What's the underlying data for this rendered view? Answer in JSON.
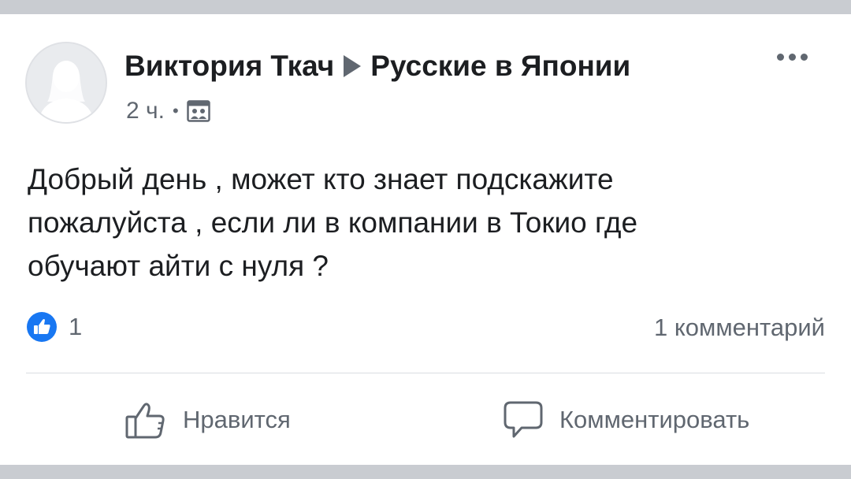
{
  "post": {
    "author": "Виктория Ткач",
    "group": "Русские в Японии",
    "time": "2 ч.",
    "separator": "•",
    "audience_icon": "group-audience-icon",
    "text": "Добрый день  , может кто знает подскажите\nпожалуйста , если ли в компании в Токио  где\nобучают айти с нуля ?"
  },
  "stats": {
    "reaction_icon": "like-reaction-icon",
    "reaction_count": "1",
    "comments": "1 комментарий"
  },
  "actions": {
    "like_label": "Нравится",
    "comment_label": "Комментировать"
  },
  "colors": {
    "text": "#1c1e21",
    "secondary": "#606770",
    "like_blue": "#1877f2",
    "band": "#c9ccd1"
  }
}
